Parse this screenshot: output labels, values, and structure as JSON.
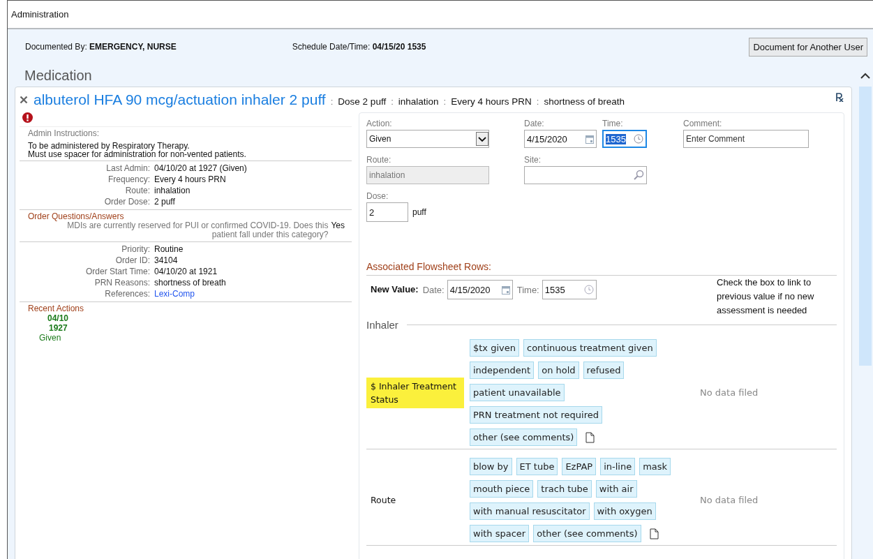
{
  "window": {
    "title": "Administration"
  },
  "header": {
    "documented_by_label": "Documented By:",
    "documented_by": "EMERGENCY, NURSE",
    "schedule_label": "Schedule Date/Time:",
    "schedule": "04/15/20 1535",
    "button": "Document for Another User"
  },
  "section_title": "Medication",
  "medication": {
    "name": "albuterol HFA 90 mcg/actuation inhaler 2 puff",
    "separator": ":",
    "summary": [
      "Dose 2 puff",
      "inhalation",
      "Every 4 hours PRN",
      "shortness of breath"
    ]
  },
  "details": {
    "admin_instructions_label": "Admin Instructions:",
    "admin_instructions": [
      "To be administered by Respiratory Therapy.",
      "Must use spacer for administration for non-vented patients."
    ],
    "order_fields": [
      {
        "label": "Last Admin:",
        "value": "04/10/20 at 1927  (Given)"
      },
      {
        "label": "Frequency:",
        "value": "Every 4 hours PRN"
      },
      {
        "label": "Route:",
        "value": "inhalation"
      },
      {
        "label": "Order Dose:",
        "value": "2 puff"
      }
    ],
    "questions_title": "Order Questions/Answers",
    "questions": [
      {
        "question": "MDIs are currently reserved for PUI or confirmed COVID-19. Does this patient fall under this category?",
        "answer": "Yes"
      }
    ],
    "order_info": [
      {
        "label": "Priority:",
        "value": "Routine",
        "kind": "text"
      },
      {
        "label": "Order ID:",
        "value": "34104",
        "kind": "text"
      },
      {
        "label": "Order Start Time:",
        "value": "04/10/20 at 1921",
        "kind": "text"
      },
      {
        "label": "PRN Reasons:",
        "value": "shortness of breath",
        "kind": "text"
      },
      {
        "label": "References:",
        "value": "Lexi-Comp",
        "kind": "link"
      }
    ],
    "recent_actions_title": "Recent Actions",
    "recent_actions": [
      {
        "date": "04/10",
        "time": "1927",
        "action": "Given"
      }
    ]
  },
  "form": {
    "action": {
      "label": "Action:",
      "value": "Given"
    },
    "date": {
      "label": "Date:",
      "value": "4/15/2020"
    },
    "time": {
      "label": "Time:",
      "value": "1535",
      "focused": true
    },
    "comment": {
      "label": "Comment:",
      "placeholder": "Enter Comment"
    },
    "route": {
      "label": "Route:",
      "value": "inhalation",
      "disabled": true
    },
    "site": {
      "label": "Site:"
    },
    "dose": {
      "label": "Dose:",
      "value": "2",
      "unit": "puff"
    }
  },
  "flowsheet": {
    "title": "Associated Flowsheet Rows:",
    "new_value_label": "New Value:",
    "date_label": "Date:",
    "date": "4/15/2020",
    "time_label": "Time:",
    "time": "1535",
    "hint": "Check the box to link to previous value if no new assessment is needed",
    "group": "Inhaler",
    "rows": [
      {
        "label": "$ Inhaler Treatment Status",
        "highlighted": true,
        "status": "No data filed",
        "options": [
          {
            "label": "$tx given",
            "selected": false
          },
          {
            "label": "continuous treatment given",
            "selected": false
          },
          {
            "label": "independent",
            "selected": false
          },
          {
            "label": "on hold",
            "selected": false
          },
          {
            "label": "refused",
            "selected": false
          },
          {
            "label": "patient unavailable",
            "selected": false
          },
          {
            "label": "PRN treatment not required",
            "selected": false
          },
          {
            "label": "other (see comments)",
            "selected": false
          }
        ]
      },
      {
        "label": "Route",
        "highlighted": false,
        "status": "No data filed",
        "options": [
          {
            "label": "blow by",
            "selected": false
          },
          {
            "label": "ET tube",
            "selected": false
          },
          {
            "label": "EzPAP",
            "selected": false
          },
          {
            "label": "in-line",
            "selected": false
          },
          {
            "label": "mask",
            "selected": false
          },
          {
            "label": "mouth piece",
            "selected": false
          },
          {
            "label": "trach tube",
            "selected": false
          },
          {
            "label": "with air",
            "selected": false
          },
          {
            "label": "with manual resuscitator",
            "selected": false
          },
          {
            "label": "with oxygen",
            "selected": false
          },
          {
            "label": "with spacer",
            "selected": false
          },
          {
            "label": "other (see comments)",
            "selected": false
          }
        ]
      }
    ]
  }
}
